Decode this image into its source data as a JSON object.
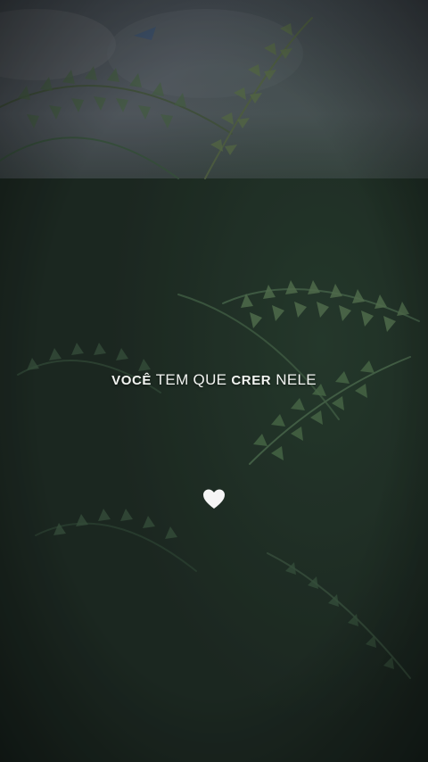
{
  "caption": {
    "part1": "VOCÊ",
    "part2": " TEM QUE ",
    "part3": "CRER",
    "part4": " NELE"
  },
  "heart": {
    "icon": "white-heart-icon",
    "color": "#f5f5f5"
  },
  "scene": {
    "subject": "fern-like foliage against overcast sky",
    "palette": {
      "sky": "#5a6068",
      "foliage_dark": "#18221c",
      "foliage_mid": "#2f4a38",
      "foliage_light": "#5f7a55",
      "text": "#f2f4f1"
    }
  }
}
